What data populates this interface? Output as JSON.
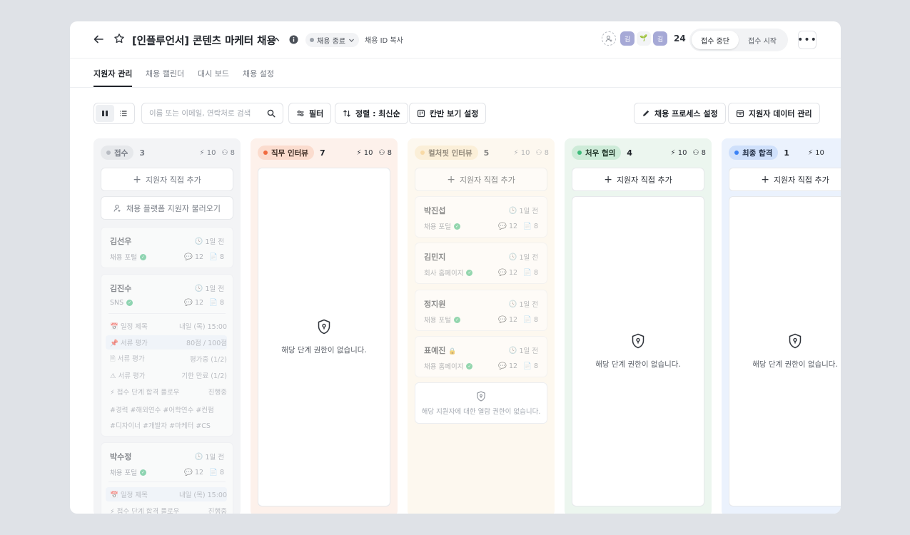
{
  "header": {
    "title": "[인플루언서] 콘텐츠 마케터 채용",
    "status": "채용 종료",
    "copy_id": "채용 ID 복사",
    "avatars": [
      "김",
      "🌱",
      "김"
    ],
    "member_count": "24",
    "seg_stop": "접수 중단",
    "seg_start": "접수 시작"
  },
  "tabs": [
    "지원자 관리",
    "채용 캘린더",
    "대시 보드",
    "채용 설정"
  ],
  "toolbar": {
    "search_placeholder": "이름 또는 이메일, 연락처로 검색",
    "filter": "필터",
    "sort": "정렬 : 최신순",
    "kanban": "칸반 보기 설정",
    "process": "채용 프로세스 설정",
    "data": "지원자 데이터 관리"
  },
  "columns": [
    {
      "title": "접수",
      "count": "3",
      "s1": "10",
      "s2": "8",
      "dot": "#b7bbc2",
      "add": "지원자 직접 추가",
      "import": "채용 플랫폼 지원자 불러오기",
      "cards": [
        {
          "name": "김선우",
          "time": "1일 전",
          "source": "채용 포털",
          "c": "12",
          "d": "8"
        },
        {
          "name": "김진수",
          "time": "1일 전",
          "source": "SNS",
          "c": "12",
          "d": "8",
          "details": [
            {
              "label": "일정 제목",
              "value": "내일 (목) 15:00"
            },
            {
              "label": "서류 평가",
              "value": "80점 / 100점"
            },
            {
              "label": "서류 평가",
              "value": "평가중 (1/2)"
            },
            {
              "label": "서류 평가",
              "value": "기한 만료 (1/2)"
            },
            {
              "label": "접수 단계 합격 플로우",
              "value": "진행중"
            }
          ],
          "tags1": "#경력    #해외연수    #어학연수    #컨펌",
          "tags2": "#디자이너    #개발자    #마케터    #CS"
        },
        {
          "name": "박수정",
          "time": "1일 전",
          "source": "채용 포털",
          "c": "12",
          "d": "8",
          "details": [
            {
              "label": "일정 제목",
              "value": "내일 (목) 15:00"
            },
            {
              "label": "접수 단계 합격 플로우",
              "value": "진행중"
            }
          ]
        }
      ]
    },
    {
      "title": "직무 인터뷰",
      "count": "7",
      "s1": "10",
      "s2": "8",
      "dot": "#f06a3f",
      "empty": "해당 단계 권한이 없습니다."
    },
    {
      "title": "컬처핏 인터뷰",
      "count": "5",
      "s1": "10",
      "s2": "8",
      "dot": "#f4c26b",
      "add": "지원자 직접 추가",
      "cards": [
        {
          "name": "박진섭",
          "time": "1일 전",
          "source": "채용 포털",
          "c": "12",
          "d": "8"
        },
        {
          "name": "김민지",
          "time": "1일 전",
          "source": "회사 홈페이지",
          "c": "12",
          "d": "8"
        },
        {
          "name": "정지원",
          "time": "1일 전",
          "source": "채용 포털",
          "c": "12",
          "d": "8"
        },
        {
          "name": "표예진",
          "time": "1일 전",
          "source": "채용 홈페이지",
          "c": "12",
          "d": "8"
        }
      ],
      "locked": "해당 지원자에 대한 열람 권한이 없습니다."
    },
    {
      "title": "처우 협의",
      "count": "4",
      "s1": "10",
      "s2": "8",
      "dot": "#3dbb7a",
      "add": "지원자 직접 추가",
      "empty": "해당 단계 권한이 없습니다."
    },
    {
      "title": "최종 합격",
      "count": "1",
      "s1": "10",
      "dot": "#3b82f6",
      "add": "지원자 직접 추가",
      "empty": "해당 단계 권한이 없습니다."
    }
  ]
}
